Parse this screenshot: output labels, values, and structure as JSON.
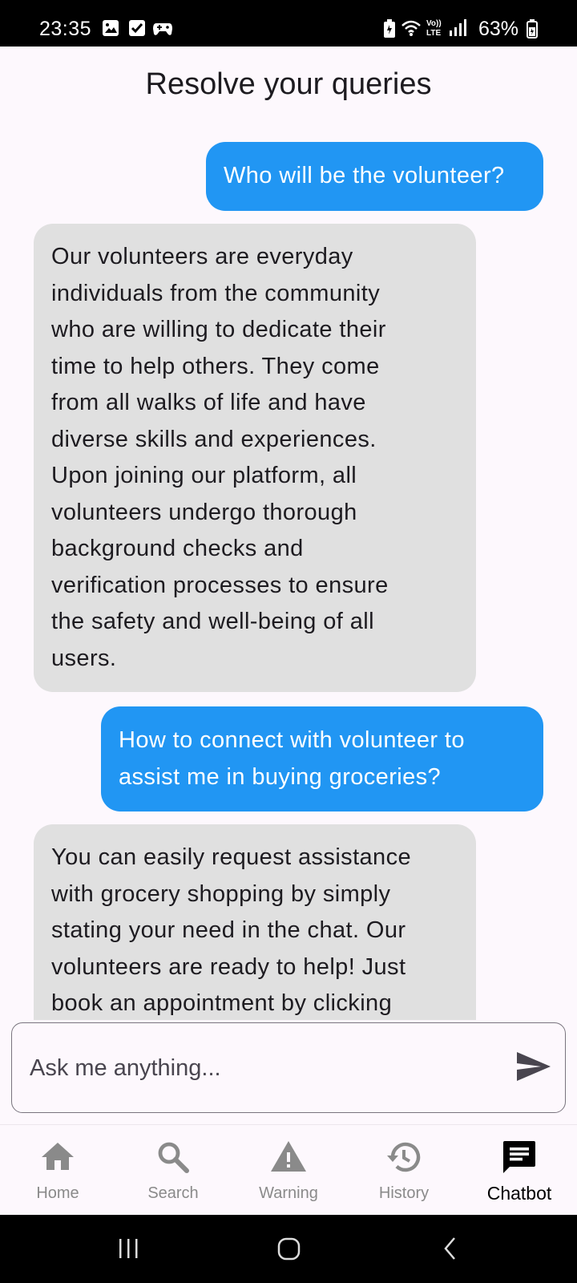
{
  "status_bar": {
    "time": "23:35",
    "battery": "63%",
    "icons": [
      "gallery-icon",
      "check-icon",
      "gamepad-icon",
      "battery-saver-icon",
      "wifi-icon",
      "volte-icon",
      "signal-icon",
      "battery-icon"
    ]
  },
  "header": {
    "title": "Resolve your queries"
  },
  "messages": [
    {
      "role": "user",
      "lines": [
        "Who will be the volunteer?"
      ]
    },
    {
      "role": "bot",
      "lines": [
        "Our volunteers are everyday",
        "individuals from the community",
        "who are willing to dedicate their",
        "time to help others. They come",
        "from all walks of life and have",
        "diverse skills and experiences.",
        "Upon joining our platform, all",
        "volunteers undergo thorough",
        "background checks and",
        "verification processes to ensure",
        "the safety and well-being of all",
        "users."
      ]
    },
    {
      "role": "user",
      "lines": [
        "How to connect with volunteer to",
        "assist me in buying groceries?"
      ]
    },
    {
      "role": "bot",
      "lines": [
        "You can easily request assistance",
        "with grocery shopping by simply",
        "stating your need in the chat. Our",
        "volunteers are ready to help! Just",
        "book an appointment by clicking"
      ]
    }
  ],
  "input": {
    "placeholder": "Ask me anything..."
  },
  "nav": {
    "items": [
      {
        "label": "Home",
        "icon": "home-icon"
      },
      {
        "label": "Search",
        "icon": "search-icon"
      },
      {
        "label": "Warning",
        "icon": "warning-icon"
      },
      {
        "label": "History",
        "icon": "history-icon"
      },
      {
        "label": "Chatbot",
        "icon": "chat-icon",
        "active": true
      }
    ]
  },
  "colors": {
    "user_bubble": "#2196f3",
    "bot_bubble": "#e0e0e0",
    "background": "#fdf8fd",
    "nav_inactive": "#8a8a8a"
  }
}
